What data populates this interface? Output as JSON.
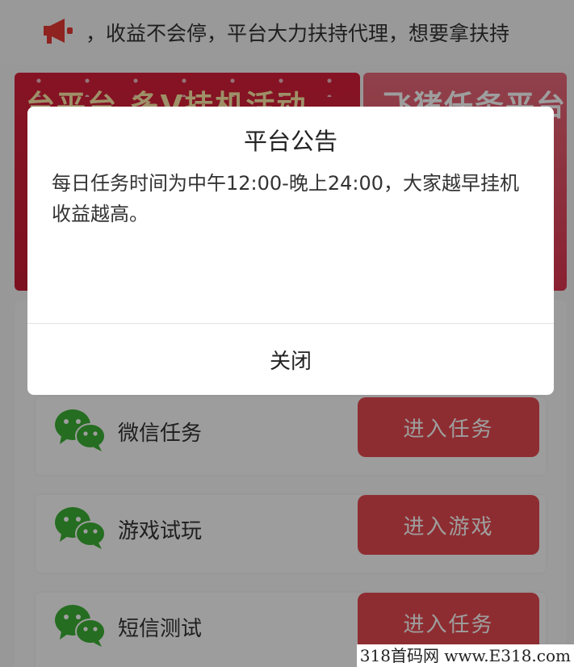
{
  "notice": {
    "icon": "megaphone-icon",
    "text": "，收益不会停，平台大力扶持代理，想要拿扶持"
  },
  "banners": [
    {
      "headline": "台平台 多V挂机活动"
    },
    {
      "headline": "飞猪任务平台"
    }
  ],
  "tasks": [
    {
      "icon": "wechat-icon",
      "label": "微信任务",
      "button": "进入任务"
    },
    {
      "icon": "wechat-icon",
      "label": "游戏试玩",
      "button": "进入游戏"
    },
    {
      "icon": "wechat-icon",
      "label": "短信测试",
      "button": "进入任务"
    }
  ],
  "modal": {
    "title": "平台公告",
    "body": "每日任务时间为中午12:00-晚上24:00，大家越早挂机收益越高。",
    "close_label": "关闭"
  },
  "watermark": "318首码网 www.E318.com",
  "colors": {
    "accent": "#e64a4f",
    "wechat_green": "#3cb034",
    "speaker_red": "#e53935"
  }
}
